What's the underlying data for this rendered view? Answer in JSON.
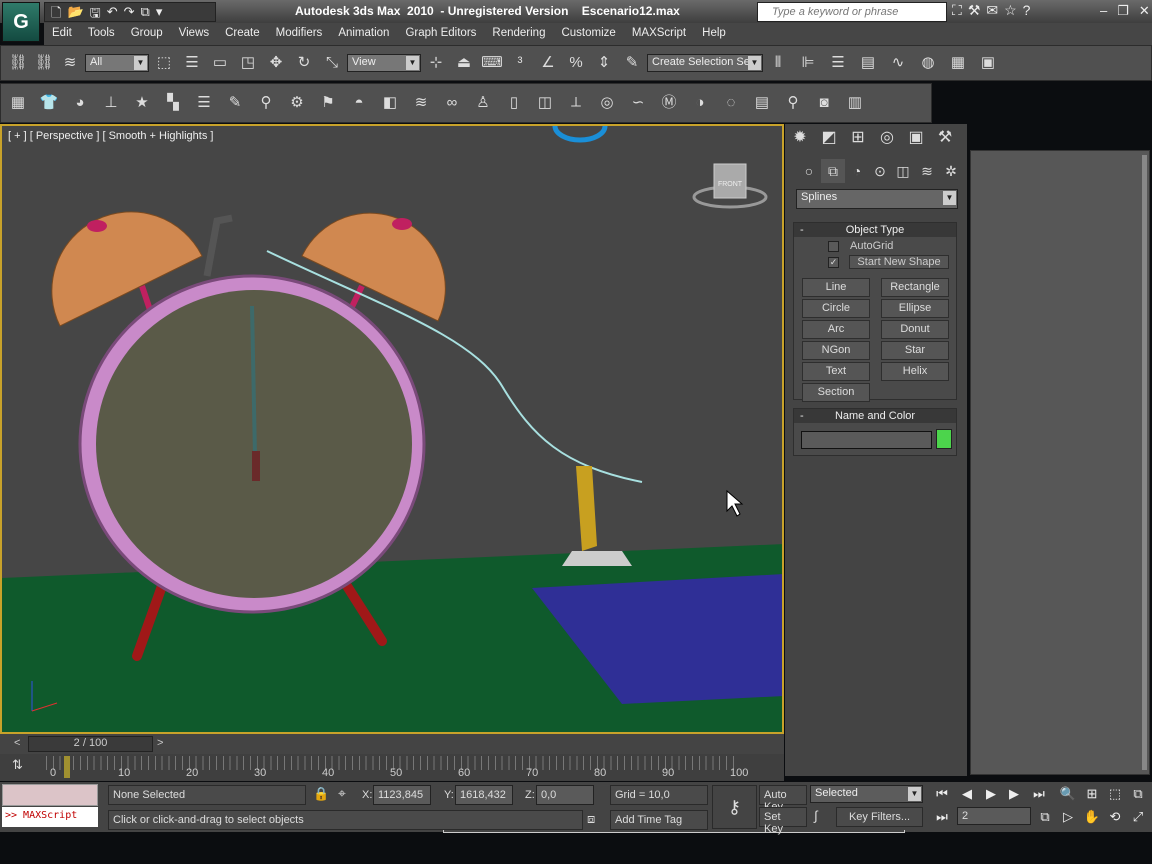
{
  "app": {
    "title": "Autodesk 3ds Max  2010  - Unregistered Version    Escenario12.max",
    "logo": "3ds Max"
  },
  "search": {
    "placeholder": "Type a keyword or phrase"
  },
  "menu": [
    "Edit",
    "Tools",
    "Group",
    "Views",
    "Create",
    "Modifiers",
    "Animation",
    "Graph Editors",
    "Rendering",
    "Customize",
    "MAXScript",
    "Help"
  ],
  "toolbar": {
    "selection_filter": "All",
    "ref_coord": "View",
    "named_selection": "Create Selection Se",
    "icons1a": [
      "link-icon",
      "unlink-icon",
      "bind-spacewarp-icon"
    ],
    "icons1b": [
      "select-object-icon",
      "select-by-name-icon",
      "rect-selection-icon",
      "window-crossing-icon",
      "move-icon",
      "rotate-icon",
      "scale-icon"
    ],
    "icons1c": [
      "pivot-icon",
      "select-manipulate-icon",
      "keyboard-shortcut-icon",
      "snap-3d-icon",
      "angle-snap-icon",
      "percent-snap-icon",
      "spinner-snap-icon",
      "edit-named-selection-icon"
    ],
    "icons1d": [
      "mirror-icon",
      "align-icon",
      "layer-manager-icon",
      "schematic-view-icon",
      "curve-editor-icon",
      "material-editor-icon",
      "render-setup-icon",
      "rendered-frame-icon"
    ],
    "icons2": [
      "box-icon",
      "tshirt-icon",
      "sphere-icon",
      "plane-icon",
      "star-icon",
      "checker-icon",
      "cylinder-icon",
      "pencil-icon",
      "brush-icon",
      "gear-icon",
      "windvane-icon",
      "dog-icon",
      "cloth-icon",
      "wave-icon",
      "torus-knot-icon",
      "biped-icon",
      "door-icon",
      "cameras-icon",
      "bone-icon",
      "wheel-icon",
      "rope-icon",
      "m-tshirt-icon",
      "m-sphere-icon",
      "m-spiral-icon",
      "notes-icon",
      "quick-render-icon",
      "render-icon",
      "film-icon"
    ]
  },
  "viewport": {
    "label": "[ + ] [ Perspective ] [ Smooth + Highlights ]",
    "viewcube": "FRONT"
  },
  "command_panel": {
    "category": "Splines",
    "object_type": {
      "title": "Object Type",
      "autogrid": "AutoGrid",
      "autogrid_checked": false,
      "start_new_shape": "Start New Shape",
      "start_new_shape_checked": true,
      "buttons": [
        "Line",
        "Rectangle",
        "Circle",
        "Ellipse",
        "Arc",
        "Donut",
        "NGon",
        "Star",
        "Text",
        "Helix",
        "Section"
      ]
    },
    "name_color": {
      "title": "Name and Color",
      "name": "",
      "color": "#4cd44c"
    }
  },
  "timeline": {
    "frame": "2 / 100",
    "ticks": [
      "0",
      "10",
      "20",
      "30",
      "40",
      "50",
      "60",
      "70",
      "80",
      "90",
      "100"
    ],
    "current": 2,
    "total": 100
  },
  "status": {
    "maxscript": ">> MAXScript",
    "selection": "None Selected",
    "x_label": "X:",
    "x": "1123,845",
    "y_label": "Y:",
    "y": "1618,432",
    "z_label": "Z:",
    "z": "0,0",
    "grid": "Grid = 10,0",
    "prompt": "Click or click-and-drag to select objects",
    "add_time_tag": "Add Time Tag",
    "auto_key": "Auto Key",
    "set_key": "Set Key",
    "key_mode": "Selected",
    "key_filters": "Key Filters...",
    "frame": "2"
  }
}
